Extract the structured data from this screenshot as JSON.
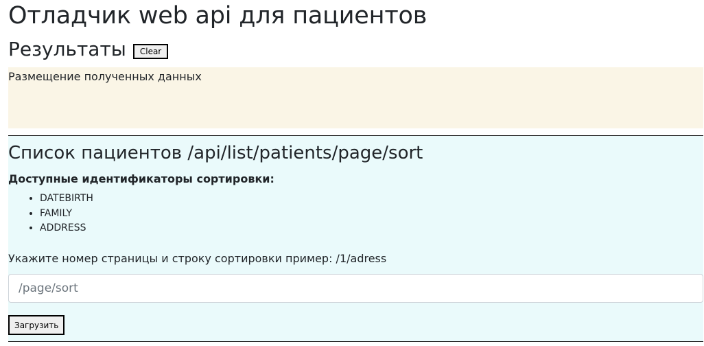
{
  "page": {
    "title": "Отладчик web api для пациентов"
  },
  "results": {
    "heading": "Результаты",
    "clear_label": "Clear",
    "output_placeholder": "Размещение полученных данных"
  },
  "patients_section": {
    "heading": "Список пациентов /api/list/patients/page/sort",
    "sort_label": "Доступные идентификаторы сортировки:",
    "sort_ids": [
      "DATEBIRTH",
      "FAMILY",
      "ADDRESS"
    ],
    "hint": "Укажите номер страницы и строку сортировки пример: /1/adress",
    "input": {
      "placeholder": "/page/sort",
      "value": ""
    },
    "load_label": "Загрузить"
  },
  "colors": {
    "output_background": "#faf5e6",
    "section_background": "#eafafb",
    "text": "#212529"
  }
}
